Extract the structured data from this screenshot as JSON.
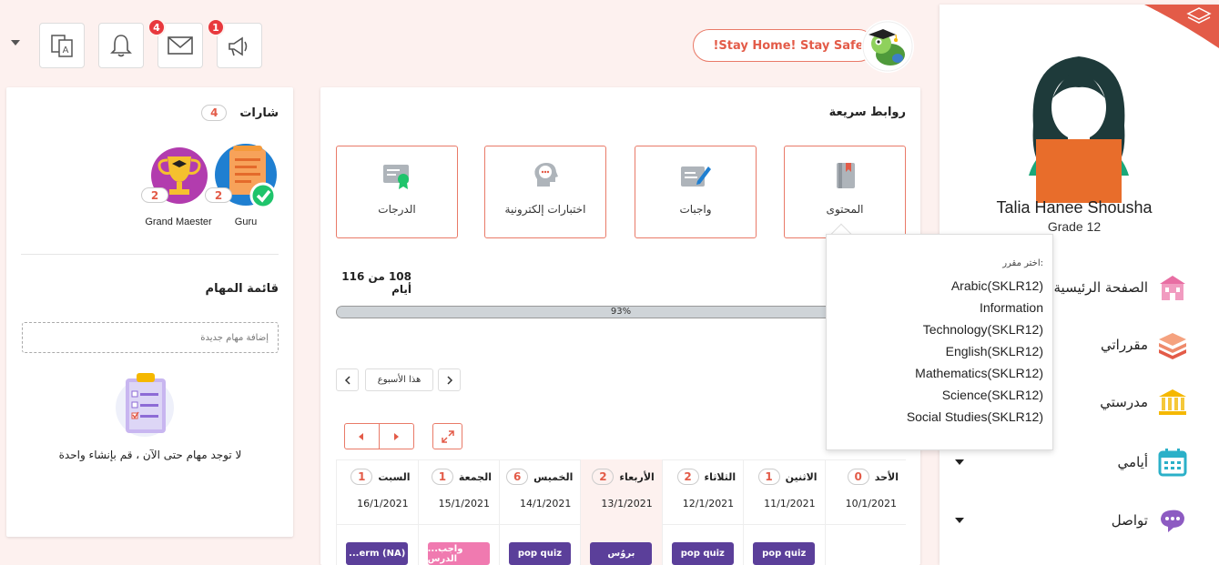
{
  "topbar": {
    "stay_home": "!Stay Home! Stay Safe",
    "messages_count": "4",
    "announcements_count": "1"
  },
  "user": {
    "name": "Talia Hanee Shousha",
    "grade": "Grade 12"
  },
  "nav": {
    "items": [
      {
        "label": "الصفحة الرئيسية",
        "icon": "school-building-icon"
      },
      {
        "label": "مقرراتي",
        "icon": "books-icon"
      },
      {
        "label": "مدرستي",
        "icon": "institution-icon"
      },
      {
        "label": "أيامي",
        "icon": "calendar-icon"
      },
      {
        "label": "تواصل",
        "icon": "chat-icon"
      }
    ]
  },
  "badges": {
    "title": "شارات",
    "count": "4",
    "items": [
      {
        "name": "Guru",
        "count": "2"
      },
      {
        "name": "Grand Maester",
        "count": "2"
      }
    ]
  },
  "tasks": {
    "title": "قائمة المهام",
    "placeholder": "إضافة مهام جديدة",
    "empty": "لا توجد مهام حتى الآن ، قم بإنشاء واحدة"
  },
  "quick_links": {
    "title": "روابط سريعة",
    "tiles": [
      "المحتوى",
      "واجبات",
      "اختبارات إلكترونية",
      "الدرجات"
    ]
  },
  "progress": {
    "days_label": "108 من 116 أيام",
    "percent": 93,
    "percent_label": "93%"
  },
  "week": {
    "this_week": "هذا الأسبوع",
    "days": [
      {
        "name": "الأحد",
        "count": "0",
        "date": "10/1/2021",
        "event": ""
      },
      {
        "name": "الاثنين",
        "count": "1",
        "date": "11/1/2021",
        "event": "pop quiz"
      },
      {
        "name": "الثلاثاء",
        "count": "2",
        "date": "12/1/2021",
        "event": "pop quiz"
      },
      {
        "name": "الأربعاء",
        "count": "2",
        "date": "13/1/2021",
        "event": "بروُس"
      },
      {
        "name": "الخميس",
        "count": "6",
        "date": "14/1/2021",
        "event": "pop quiz"
      },
      {
        "name": "الجمعة",
        "count": "1",
        "date": "15/1/2021",
        "event": "...واجب الدرس"
      },
      {
        "name": "السبت",
        "count": "1",
        "date": "16/1/2021",
        "event": "...erm (NA)"
      }
    ]
  },
  "course_popup": {
    "label": "اختر مقرر:",
    "courses": [
      "Arabic(SKLR12)",
      "Information",
      "Technology(SKLR12)",
      "English(SKLR12)",
      "Mathematics(SKLR12)",
      "Science(SKLR12)",
      "Social Studies(SKLR12)"
    ]
  },
  "colors": {
    "accent": "#e35b48",
    "event_purple": "#5b3f9a",
    "event_pink": "#f07ab0",
    "today_bg": "#fdf1ef"
  }
}
